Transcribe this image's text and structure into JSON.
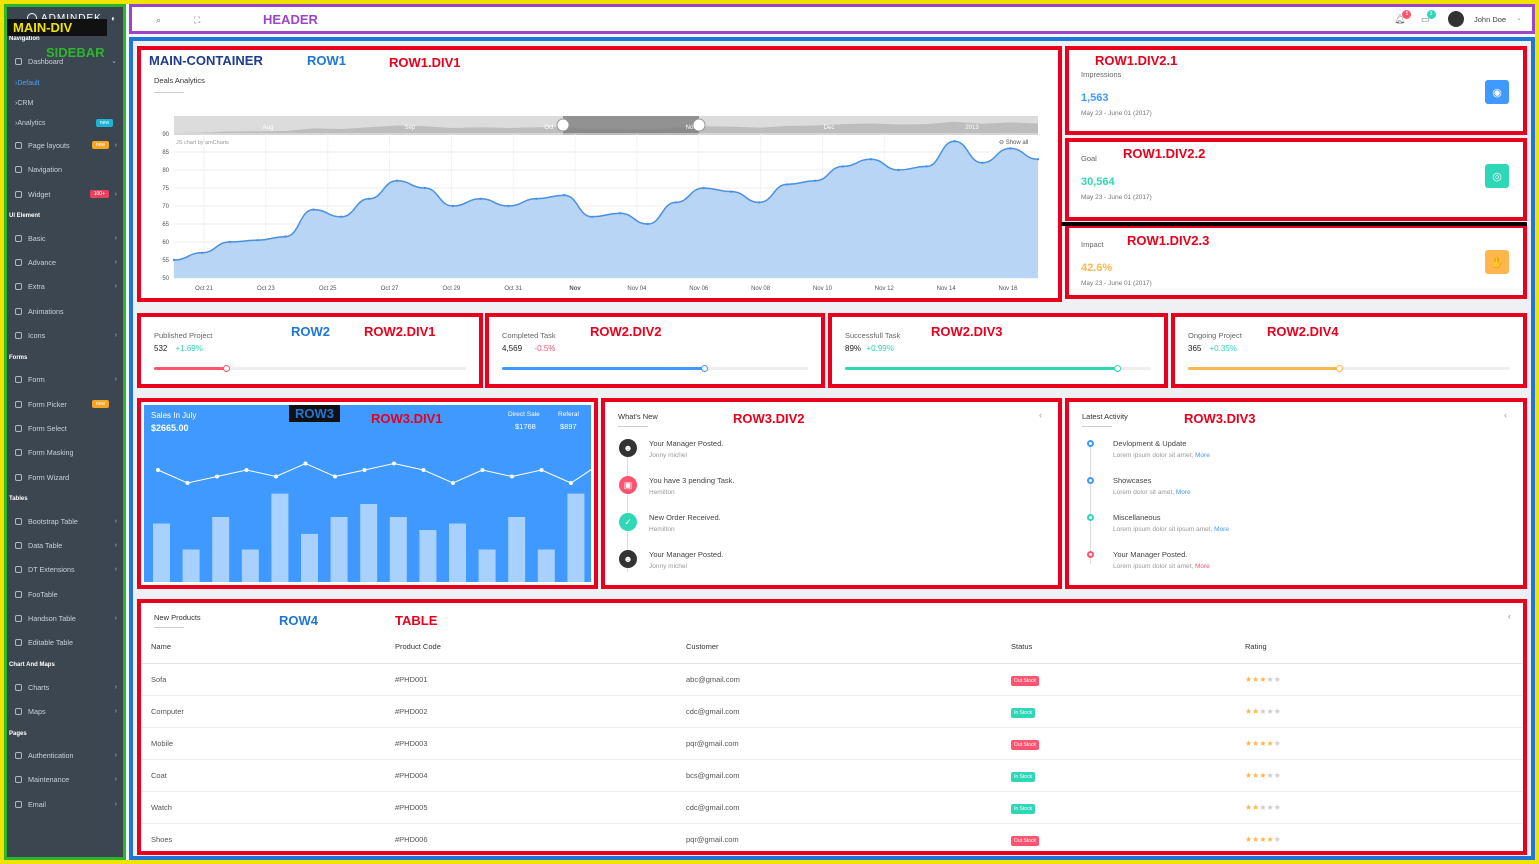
{
  "annotations": {
    "main_div": "MAIN-DIV",
    "sidebar": "SIDEBAR",
    "header": "HEADER",
    "main_container": "MAIN-CONTAINER",
    "row1": "ROW1",
    "row1_div1": "ROW1.DIV1",
    "row1_div2_1": "ROW1.DIV2.1",
    "row1_div2_2": "ROW1.DIV2.2",
    "row1_div2_3": "ROW1.DIV2.3",
    "row2": "ROW2",
    "row2_div1": "ROW2.DIV1",
    "row2_div2": "ROW2.DIV2",
    "row2_div3": "ROW2.DIV3",
    "row2_div4": "ROW2.DIV4",
    "row3": "ROW3",
    "row3_div1": "ROW3.DIV1",
    "row3_div2": "ROW3.DIV2",
    "row3_div3": "ROW3.DIV3",
    "row4": "ROW4",
    "table": "TABLE"
  },
  "brand": "ADMINDEK",
  "sidebar": {
    "sections": [
      {
        "title": "Navigation",
        "items": [
          {
            "label": "Dashboard",
            "chev": "⌄",
            "badge": "",
            "badge_color": ""
          }
        ]
      },
      {
        "title": "",
        "subs": [
          "Default",
          "CRM",
          "Analytics"
        ],
        "sub_badge": "new"
      },
      {
        "title": "",
        "items": [
          {
            "label": "Page layouts",
            "chev": "›",
            "badge": "new",
            "badge_color": "#f5a623"
          },
          {
            "label": "Navigation",
            "chev": "",
            "badge": "",
            "badge_color": ""
          },
          {
            "label": "Widget",
            "chev": "›",
            "badge": "100+",
            "badge_color": "#e8415c"
          }
        ]
      },
      {
        "title": "UI Element",
        "items": [
          {
            "label": "Basic",
            "chev": "›",
            "badge": "",
            "badge_color": ""
          },
          {
            "label": "Advance",
            "chev": "›",
            "badge": "",
            "badge_color": ""
          },
          {
            "label": "Extra",
            "chev": "›",
            "badge": "",
            "badge_color": ""
          },
          {
            "label": "Animations",
            "chev": "",
            "badge": "",
            "badge_color": ""
          },
          {
            "label": "Icons",
            "chev": "›",
            "badge": "",
            "badge_color": ""
          }
        ]
      },
      {
        "title": "Forms",
        "items": [
          {
            "label": "Form",
            "chev": "›",
            "badge": "",
            "badge_color": ""
          },
          {
            "label": "Form Picker",
            "chev": "",
            "badge": "new",
            "badge_color": "#f5a623"
          },
          {
            "label": "Form Select",
            "chev": "",
            "badge": "",
            "badge_color": ""
          },
          {
            "label": "Form Masking",
            "chev": "",
            "badge": "",
            "badge_color": ""
          },
          {
            "label": "Form Wizard",
            "chev": "",
            "badge": "",
            "badge_color": ""
          }
        ]
      },
      {
        "title": "Tables",
        "items": [
          {
            "label": "Bootstrap Table",
            "chev": "›",
            "badge": "",
            "badge_color": ""
          },
          {
            "label": "Data Table",
            "chev": "›",
            "badge": "",
            "badge_color": ""
          },
          {
            "label": "DT Extensions",
            "chev": "›",
            "badge": "",
            "badge_color": ""
          },
          {
            "label": "FooTable",
            "chev": "",
            "badge": "",
            "badge_color": ""
          },
          {
            "label": "Handson Table",
            "chev": "›",
            "badge": "",
            "badge_color": ""
          },
          {
            "label": "Editable Table",
            "chev": "",
            "badge": "",
            "badge_color": ""
          }
        ]
      },
      {
        "title": "Chart And Maps",
        "items": [
          {
            "label": "Charts",
            "chev": "›",
            "badge": "",
            "badge_color": ""
          },
          {
            "label": "Maps",
            "chev": "›",
            "badge": "",
            "badge_color": ""
          }
        ]
      },
      {
        "title": "Pages",
        "items": [
          {
            "label": "Authentication",
            "chev": "›",
            "badge": "",
            "badge_color": ""
          },
          {
            "label": "Maintenance",
            "chev": "›",
            "badge": "",
            "badge_color": ""
          },
          {
            "label": "Email",
            "chev": "›",
            "badge": "",
            "badge_color": ""
          }
        ]
      }
    ]
  },
  "header": {
    "user": "John Doe",
    "notif_count": "5",
    "msg_count": "3"
  },
  "deals": {
    "title": "Deals Analytics",
    "credit": "JS chart by amCharts",
    "show_all": "Show all",
    "scroll_labels": [
      "Aug",
      "Sep",
      "Oct",
      "Nov",
      "Dec",
      "2013"
    ]
  },
  "chart_data": {
    "type": "area",
    "title": "Deals Analytics",
    "ylim": [
      50,
      90
    ],
    "yticks": [
      50,
      55,
      60,
      65,
      70,
      75,
      80,
      85,
      90
    ],
    "x_ticks": [
      "Oct 21",
      "Oct 23",
      "Oct 25",
      "Oct 27",
      "Oct 29",
      "Oct 31",
      "Nov",
      "Nov 04",
      "Nov 06",
      "Nov 08",
      "Nov 10",
      "Nov 12",
      "Nov 14",
      "Nov 16"
    ],
    "values": [
      55,
      57,
      60,
      60.5,
      61.5,
      69,
      67,
      72,
      77,
      75,
      70,
      72,
      70,
      72,
      73,
      67,
      68,
      65,
      71,
      75,
      74,
      71,
      76,
      77,
      81,
      83,
      80,
      81,
      88,
      82,
      86,
      83
    ]
  },
  "stats": [
    {
      "label": "Impressions",
      "value": "1,563",
      "sub": "May 23 - June 01 (2017)",
      "color": "#4099ff",
      "icon": "◉"
    },
    {
      "label": "Goal",
      "value": "30,564",
      "sub": "May 23 - June 01 (2017)",
      "color": "#2ed8b6",
      "icon": "◎"
    },
    {
      "label": "Impact",
      "value": "42.6%",
      "sub": "May 23 - June 01 (2017)",
      "color": "#ffb64d",
      "icon": "✋"
    }
  ],
  "progress": [
    {
      "label": "Published Project",
      "value": "532",
      "change": "+1.69%",
      "change_color": "#2ed8b6",
      "color": "#ff5370",
      "fraction": 0.23
    },
    {
      "label": "Completed Task",
      "value": "4,569",
      "change": "-0.5%",
      "change_color": "#ff5370",
      "color": "#4099ff",
      "fraction": 0.66
    },
    {
      "label": "Successfull Task",
      "value": "89%",
      "change": "+0.99%",
      "change_color": "#2ed8b6",
      "color": "#2ed8b6",
      "fraction": 0.89
    },
    {
      "label": "Ongoing Project",
      "value": "365",
      "change": "+0.35%",
      "change_color": "#2ed8b6",
      "color": "#ffb64d",
      "fraction": 0.47
    }
  ],
  "sales": {
    "title": "Sales In July",
    "amount": "$2665.00",
    "direct_label": "Direct Sale",
    "direct_value": "$1768",
    "referal_label": "Referal",
    "referal_value": "$897",
    "line": [
      7,
      5,
      6,
      7,
      6,
      8,
      6,
      7,
      8,
      7,
      5,
      7,
      6,
      7,
      5,
      8
    ],
    "bars": [
      45,
      25,
      50,
      25,
      68,
      37,
      50,
      60,
      50,
      40,
      45,
      25,
      50,
      25,
      68
    ]
  },
  "whats_new": {
    "title": "What's New",
    "items": [
      {
        "title": "Your Manager Posted.",
        "sub": "Jonny michel",
        "color": "#333",
        "icon": "☻"
      },
      {
        "title": "You have 3 pending Task.",
        "sub": "Hemilton",
        "color": "#ff5370",
        "icon": "▣"
      },
      {
        "title": "New Order Received.",
        "sub": "Hemilton",
        "color": "#2ed8b6",
        "icon": "✓"
      },
      {
        "title": "Your Manager Posted.",
        "sub": "Jonny michel",
        "color": "#333",
        "icon": "☻"
      }
    ]
  },
  "latest_activity": {
    "title": "Latest Activity",
    "items": [
      {
        "title": "Devlopment & Update",
        "sub": "Lorem ipsum dolor sit amet,",
        "more": "More",
        "color": "#4099ff"
      },
      {
        "title": "Showcases",
        "sub": "Lorem dolor sit amet,",
        "more": "More",
        "color": "#4099ff"
      },
      {
        "title": "Miscellaneous",
        "sub": "Lorem ipsum dolor sit ipsum amet,",
        "more": "More",
        "color": "#2ed8b6"
      },
      {
        "title": "Your Manager Posted.",
        "sub": "Lorem ipsum dolor sit amet,",
        "more": "More",
        "color": "#ff5370"
      }
    ]
  },
  "products": {
    "title": "New Products",
    "columns": [
      "Name",
      "Product Code",
      "Customer",
      "Status",
      "Rating"
    ],
    "rows": [
      {
        "name": "Sofa",
        "code": "#PHD001",
        "customer": "abc@gmail.com",
        "status": "Out Stock",
        "status_color": "#ff5370",
        "rating": 3
      },
      {
        "name": "Computer",
        "code": "#PHD002",
        "customer": "cdc@gmail.com",
        "status": "In Stock",
        "status_color": "#2ed8b6",
        "rating": 2
      },
      {
        "name": "Mobile",
        "code": "#PHD003",
        "customer": "pqr@gmail.com",
        "status": "Out Stock",
        "status_color": "#ff5370",
        "rating": 4
      },
      {
        "name": "Coat",
        "code": "#PHD004",
        "customer": "bcs@gmail.com",
        "status": "In Stock",
        "status_color": "#2ed8b6",
        "rating": 3
      },
      {
        "name": "Watch",
        "code": "#PHD005",
        "customer": "cdc@gmail.com",
        "status": "In Stock",
        "status_color": "#2ed8b6",
        "rating": 2
      },
      {
        "name": "Shoes",
        "code": "#PHD006",
        "customer": "pqr@gmail.com",
        "status": "Out Stock",
        "status_color": "#ff5370",
        "rating": 4
      }
    ]
  }
}
